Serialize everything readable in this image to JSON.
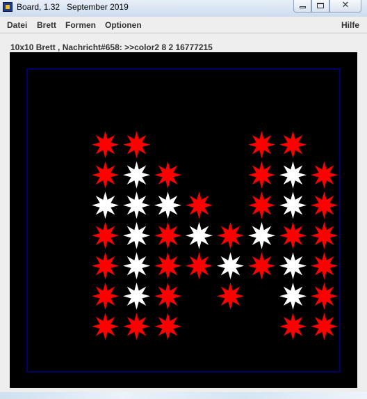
{
  "window": {
    "title": "Board, 1.32   September 2019",
    "controls": {
      "minimize": "minimize",
      "maximize": "maximize",
      "close": "close"
    }
  },
  "menu": {
    "datei": "Datei",
    "brett": "Brett",
    "formen": "Formen",
    "optionen": "Optionen",
    "hilfe": "Hilfe"
  },
  "status": {
    "text": "10x10 Brett , Nachricht#658: >>color2 8 2 16777215"
  },
  "board": {
    "rows": 10,
    "cols": 10,
    "background": "#000000",
    "grid_border_color": "#0000cc",
    "star_colors": {
      "r": "#ff0000",
      "w": "#ffffff"
    },
    "cells": [
      "..........",
      "..........",
      "..rr...rr.",
      "..rwr..rwr",
      "..wwwr.rwr",
      "..rwrwrwrr",
      "..rwrrwrwr",
      "..rwr.r.wr",
      "..rrr...rr",
      ".........."
    ]
  }
}
